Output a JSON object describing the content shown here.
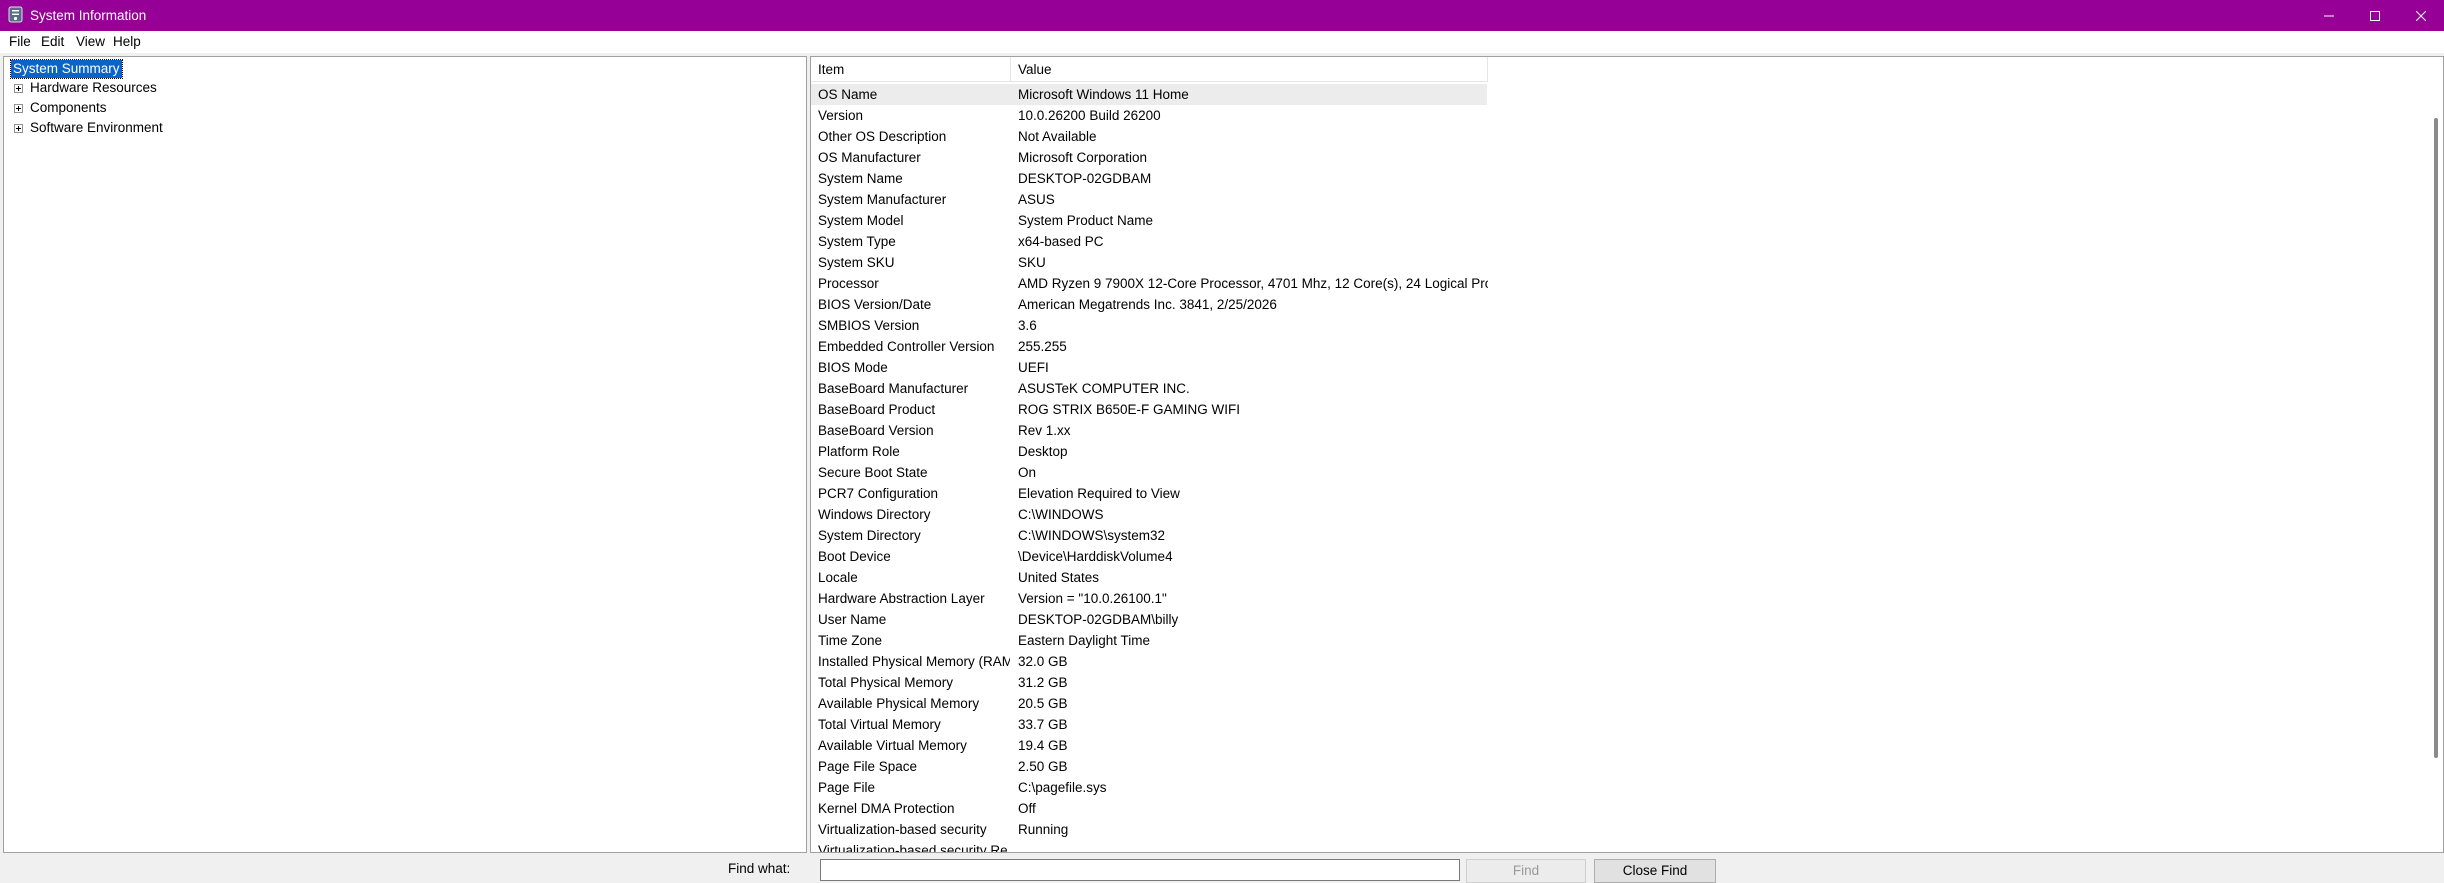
{
  "window": {
    "title": "System Information"
  },
  "menu": [
    "File",
    "Edit",
    "View",
    "Help"
  ],
  "tree": [
    {
      "label": "System Summary",
      "selected": true,
      "expandable": false
    },
    {
      "label": "Hardware Resources",
      "expandable": true
    },
    {
      "label": "Components",
      "expandable": true
    },
    {
      "label": "Software Environment",
      "expandable": true
    }
  ],
  "columns": {
    "item": "Item",
    "value": "Value"
  },
  "rows": [
    [
      "OS Name",
      "Microsoft Windows 11 Home"
    ],
    [
      "Version",
      "10.0.26200 Build 26200"
    ],
    [
      "Other OS Description",
      "Not Available"
    ],
    [
      "OS Manufacturer",
      "Microsoft Corporation"
    ],
    [
      "System Name",
      "DESKTOP-02GDBAM"
    ],
    [
      "System Manufacturer",
      "ASUS"
    ],
    [
      "System Model",
      "System Product Name"
    ],
    [
      "System Type",
      "x64-based PC"
    ],
    [
      "System SKU",
      "SKU"
    ],
    [
      "Processor",
      "AMD Ryzen 9 7900X 12-Core Processor, 4701 Mhz, 12 Core(s), 24 Logical Pro..."
    ],
    [
      "BIOS Version/Date",
      "American Megatrends Inc. 3841, 2/25/2026"
    ],
    [
      "SMBIOS Version",
      "3.6"
    ],
    [
      "Embedded Controller Version",
      "255.255"
    ],
    [
      "BIOS Mode",
      "UEFI"
    ],
    [
      "BaseBoard Manufacturer",
      "ASUSTeK COMPUTER INC."
    ],
    [
      "BaseBoard Product",
      "ROG STRIX B650E-F GAMING WIFI"
    ],
    [
      "BaseBoard Version",
      "Rev 1.xx"
    ],
    [
      "Platform Role",
      "Desktop"
    ],
    [
      "Secure Boot State",
      "On"
    ],
    [
      "PCR7 Configuration",
      "Elevation Required to View"
    ],
    [
      "Windows Directory",
      "C:\\WINDOWS"
    ],
    [
      "System Directory",
      "C:\\WINDOWS\\system32"
    ],
    [
      "Boot Device",
      "\\Device\\HarddiskVolume4"
    ],
    [
      "Locale",
      "United States"
    ],
    [
      "Hardware Abstraction Layer",
      "Version = \"10.0.26100.1\""
    ],
    [
      "User Name",
      "DESKTOP-02GDBAM\\billy"
    ],
    [
      "Time Zone",
      "Eastern Daylight Time"
    ],
    [
      "Installed Physical Memory (RAM)",
      "32.0 GB"
    ],
    [
      "Total Physical Memory",
      "31.2 GB"
    ],
    [
      "Available Physical Memory",
      "20.5 GB"
    ],
    [
      "Total Virtual Memory",
      "33.7 GB"
    ],
    [
      "Available Virtual Memory",
      "19.4 GB"
    ],
    [
      "Page File Space",
      "2.50 GB"
    ],
    [
      "Page File",
      "C:\\pagefile.sys"
    ],
    [
      "Kernel DMA Protection",
      "Off"
    ],
    [
      "Virtualization-based security",
      "Running"
    ],
    [
      "Virtualization-based security Re...",
      ""
    ]
  ],
  "find": {
    "label": "Find what:",
    "value": "",
    "find_button": "Find",
    "close_button": "Close Find"
  },
  "colors": {
    "titlebar": "#970097",
    "selection": "#0a64c8"
  }
}
